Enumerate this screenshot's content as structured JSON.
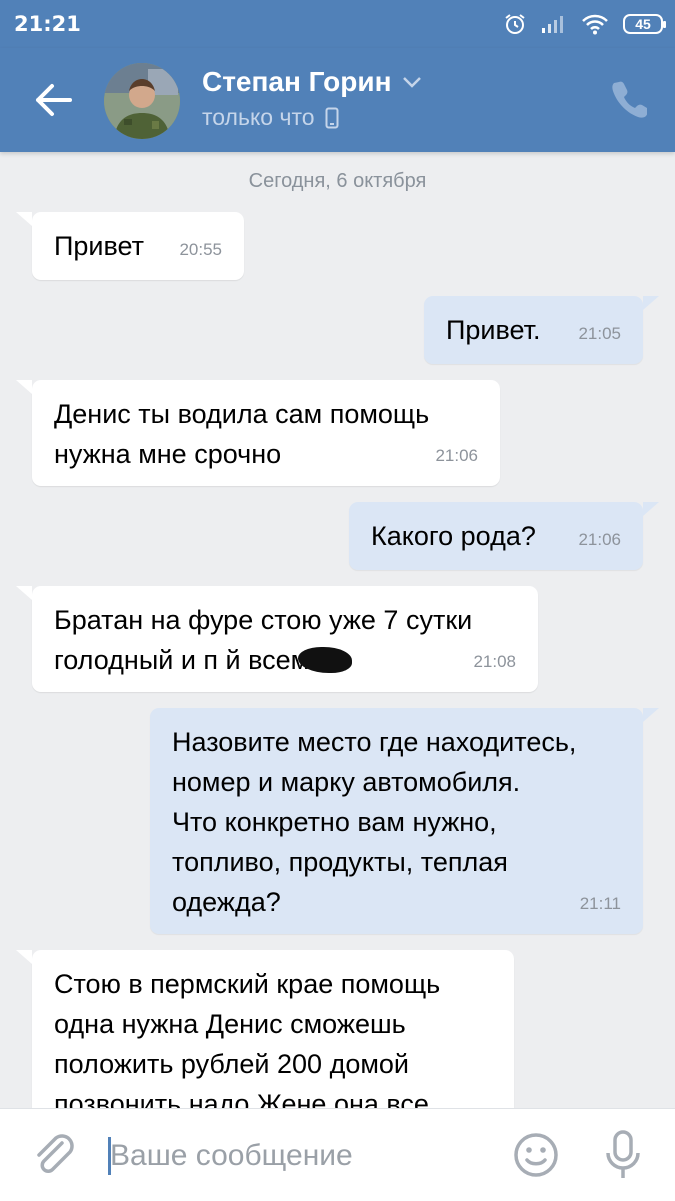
{
  "status": {
    "time": "21:21",
    "battery": "45"
  },
  "header": {
    "contact_name": "Степан Горин",
    "status_text": "только что"
  },
  "chat": {
    "date_separator": "Сегодня, 6 октября",
    "messages": [
      {
        "direction": "in",
        "text": "Привет",
        "time": "20:55"
      },
      {
        "direction": "out",
        "text": "Привет.",
        "time": "21:05"
      },
      {
        "direction": "in",
        "text": "Денис ты водила сам помощь\nнужна мне срочно",
        "time": "21:06"
      },
      {
        "direction": "out",
        "text": "Какого рода?",
        "time": "21:06"
      },
      {
        "direction": "in",
        "text": "Братан на фуре стою уже 7 сутки\nголодный и п      й всем",
        "time": "21:08"
      },
      {
        "direction": "out",
        "text": "Назовите место где находитесь,\nномер и марку автомобиля.\nЧто конкретно вам нужно,\nтопливо, продукты, теплая\nодежда?",
        "time": "21:11"
      },
      {
        "direction": "in",
        "text": "Стою в пермский крае помощь\nодна нужна Денис сможешь\nположить рублей 200 домой\nпозвонить надо Жене она все",
        "time": ""
      }
    ]
  },
  "composer": {
    "placeholder": "Ваше сообщение"
  },
  "colors": {
    "header": "#5181b8",
    "background": "#edeef0",
    "outgoing_bubble": "#dbe6f5",
    "incoming_bubble": "#ffffff"
  },
  "icons": [
    "back-arrow-icon",
    "chevron-down-icon",
    "mobile-icon",
    "phone-icon",
    "alarm-icon",
    "signal-icon",
    "wifi-icon",
    "battery-icon",
    "attach-icon",
    "emoji-icon",
    "microphone-icon"
  ]
}
